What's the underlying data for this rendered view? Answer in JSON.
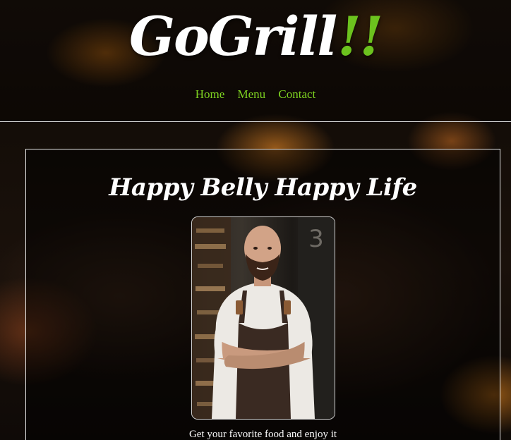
{
  "header": {
    "logo_main": "GoGrill",
    "logo_accent": "!!",
    "logo_accent_color": "#6cc21e",
    "nav": [
      {
        "label": "Home"
      },
      {
        "label": "Menu"
      },
      {
        "label": "Contact"
      }
    ],
    "nav_color": "#7ed321"
  },
  "main": {
    "title": "Happy Belly Happy Life",
    "photo_subject": "chef-portrait",
    "tagline": "Get your favorite food and enjoy it"
  }
}
